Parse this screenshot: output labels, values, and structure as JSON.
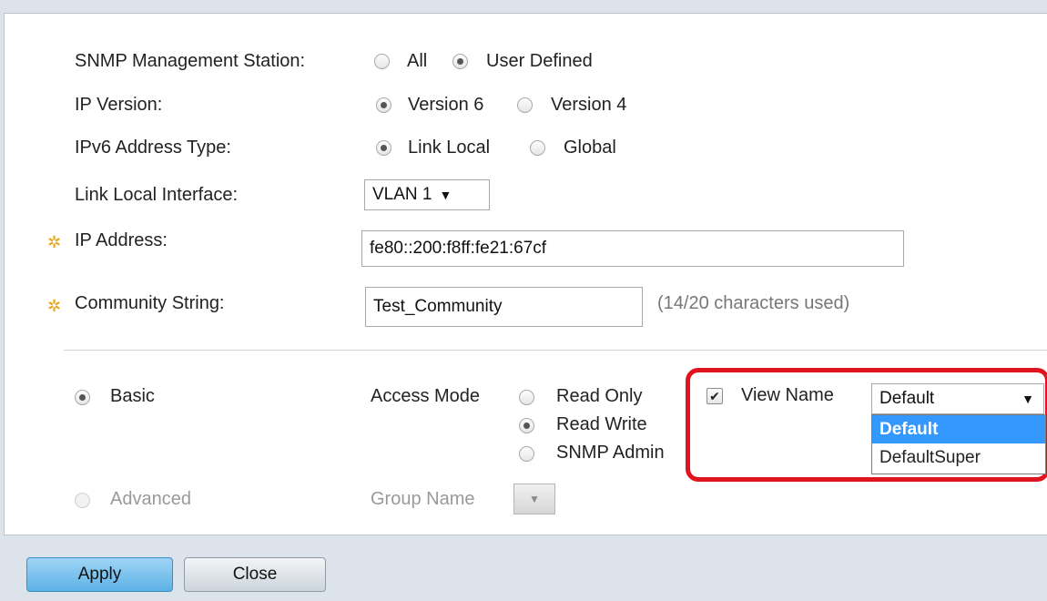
{
  "form": {
    "snmp_station": {
      "label": "SNMP Management Station:",
      "options": [
        {
          "label": "All",
          "checked": false
        },
        {
          "label": "User Defined",
          "checked": true
        }
      ]
    },
    "ip_version": {
      "label": "IP Version:",
      "options": [
        {
          "label": "Version 6",
          "checked": true
        },
        {
          "label": "Version 4",
          "checked": false
        }
      ]
    },
    "ipv6_type": {
      "label": "IPv6 Address Type:",
      "options": [
        {
          "label": "Link Local",
          "checked": true
        },
        {
          "label": "Global",
          "checked": false
        }
      ]
    },
    "link_local_interface": {
      "label": "Link Local Interface:",
      "value": "VLAN 1",
      "arrow": "▼"
    },
    "ip_address": {
      "label": "IP Address:",
      "value": "fe80::200:f8ff:fe21:67cf"
    },
    "community_string": {
      "label": "Community String:",
      "value": "Test_Community",
      "hint": "(14/20 characters used)"
    },
    "required_icon": "✲",
    "basic": {
      "label": "Basic",
      "checked": true
    },
    "access_mode": {
      "label": "Access Mode",
      "options": [
        {
          "label": "Read Only",
          "checked": false
        },
        {
          "label": "Read Write",
          "checked": true
        },
        {
          "label": "SNMP Admin",
          "checked": false
        }
      ]
    },
    "view_name": {
      "label": "View Name",
      "checked": true,
      "check_glyph": "✔",
      "selected": "Default",
      "arrow": "▼",
      "options": [
        "Default",
        "DefaultSuper"
      ]
    },
    "advanced": {
      "label": "Advanced",
      "checked": false
    },
    "group_name": {
      "label": "Group Name",
      "arrow": "▼"
    }
  },
  "buttons": {
    "apply": "Apply",
    "close": "Close"
  },
  "colors": {
    "highlight": "#e0141e",
    "selected_option": "#3399ff",
    "required_star": "#e8a317"
  }
}
